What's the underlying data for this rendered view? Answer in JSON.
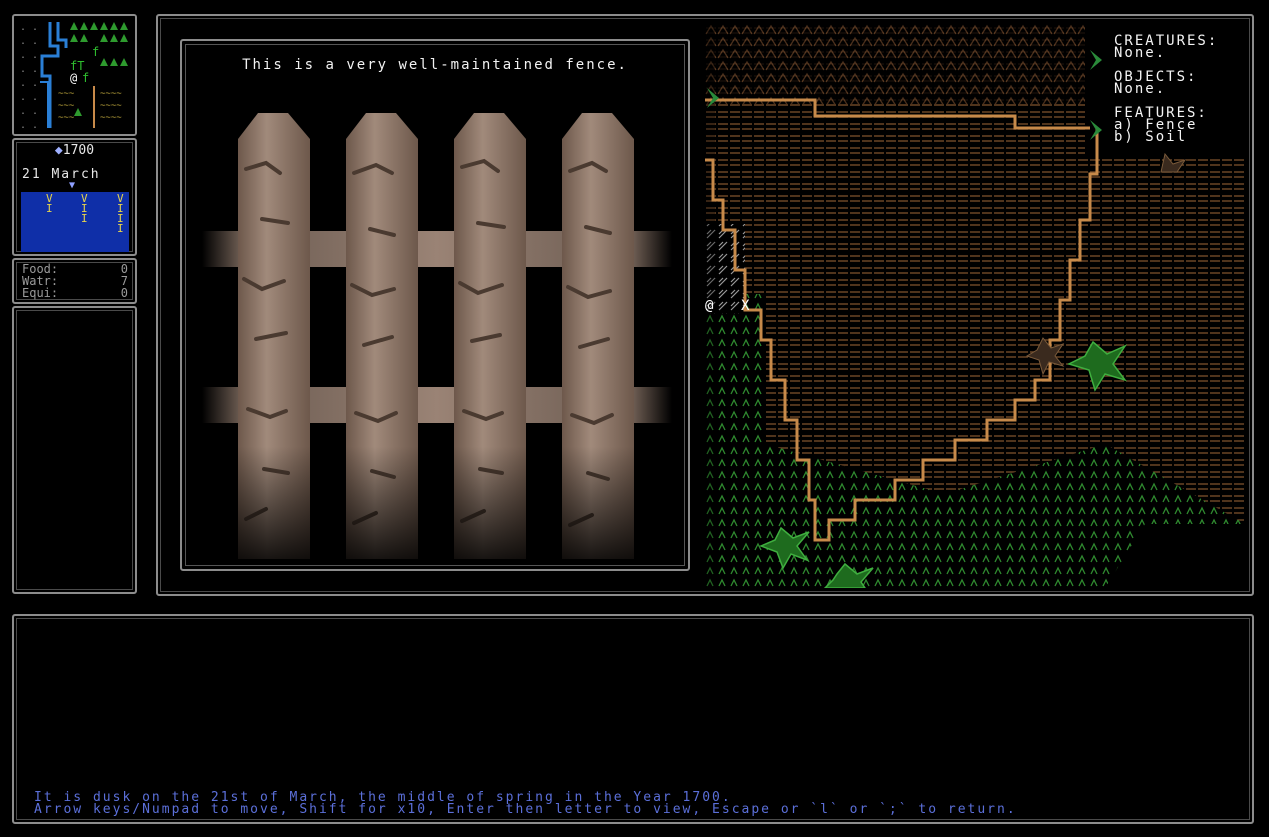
{
  "calendar": {
    "year_label": "1700",
    "date_label": "21 March"
  },
  "season_bar": {
    "marks": [
      "V\nI",
      "V\nI\nI",
      "V\nI\nI\nI"
    ]
  },
  "stats": [
    {
      "label": "Food:",
      "value": "0"
    },
    {
      "label": "Watr:",
      "value": "7"
    },
    {
      "label": "Equi:",
      "value": "0"
    }
  ],
  "viewer": {
    "description": "This is a very well-maintained fence."
  },
  "info": {
    "creatures_header": "CREATURES:",
    "creatures_value": "None.",
    "objects_header": "OBJECTS:",
    "objects_value": "None.",
    "features_header": "FEATURES:",
    "features": [
      "a) Fence",
      "b) Soil"
    ]
  },
  "map_markers": {
    "player": "@",
    "cursor": "X"
  },
  "log": {
    "message": "It is dusk on the 21st of March, the middle of spring in the Year 1700.",
    "help": "Arrow keys/Numpad to move, Shift for x10, Enter then letter to view, Escape or `l` or `;` to return."
  },
  "colors": {
    "soil": "#5a3a22",
    "path": "#c78a4a",
    "grass": "#2f8a2f",
    "river": "#2a7fd6",
    "season_bar": "#0f2fa8"
  }
}
